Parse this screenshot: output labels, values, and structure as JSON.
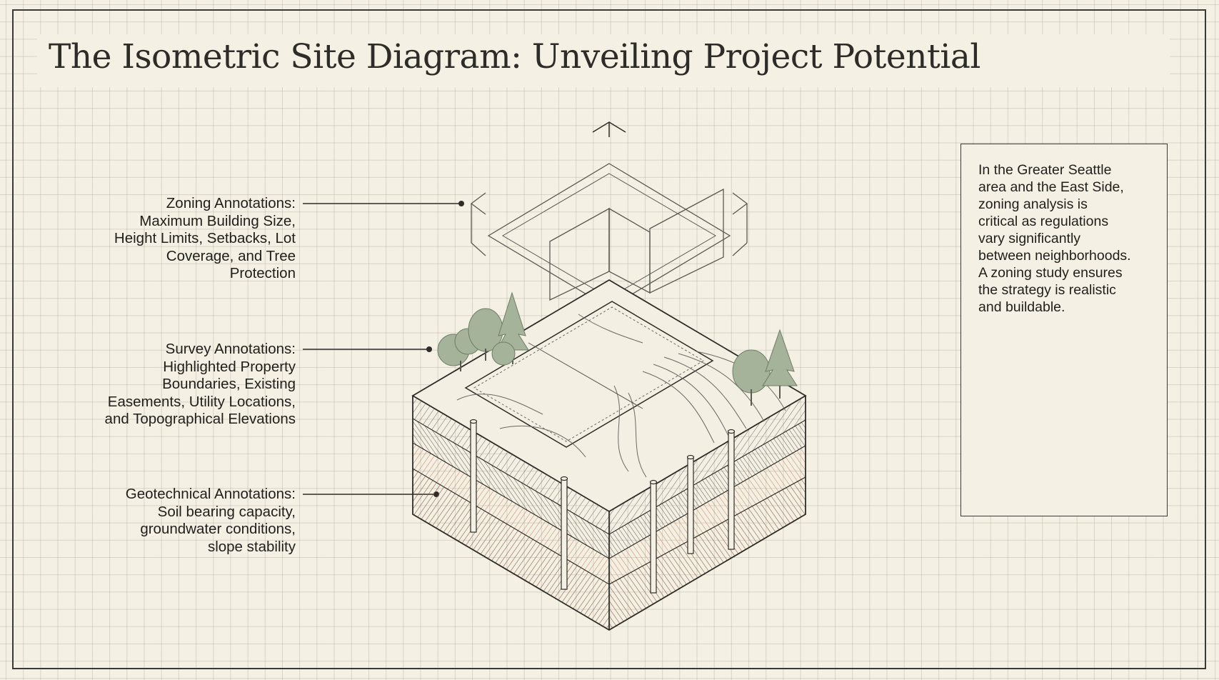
{
  "title": "The Isometric Site Diagram: Unveiling Project Potential",
  "annotations": {
    "zoning": {
      "heading": "Zoning Annotations:",
      "lines": [
        "Maximum Building Size,",
        "Height Limits, Setbacks, Lot",
        "Coverage, and Tree",
        "Protection"
      ]
    },
    "survey": {
      "heading": "Survey Annotations:",
      "lines": [
        "Highlighted Property",
        "Boundaries, Existing",
        "Easements, Utility Locations,",
        "and Topographical Elevations"
      ]
    },
    "geotechnical": {
      "heading": "Geotechnical Annotations:",
      "lines": [
        "Soil bearing capacity,",
        "groundwater conditions,",
        "slope stability"
      ]
    }
  },
  "info_box": {
    "lines": [
      "In the Greater Seattle",
      "area and the East Side,",
      "zoning analysis is",
      "critical as regulations",
      "vary significantly",
      "between neighborhoods.",
      "A zoning study ensures",
      "the strategy is realistic",
      "and buildable."
    ]
  },
  "colors": {
    "background": "#f4f0e3",
    "grid": "#a0a096",
    "ink": "#2d2c28",
    "soil_clay": "#d98a6a",
    "tree_green": "#9fb096"
  }
}
